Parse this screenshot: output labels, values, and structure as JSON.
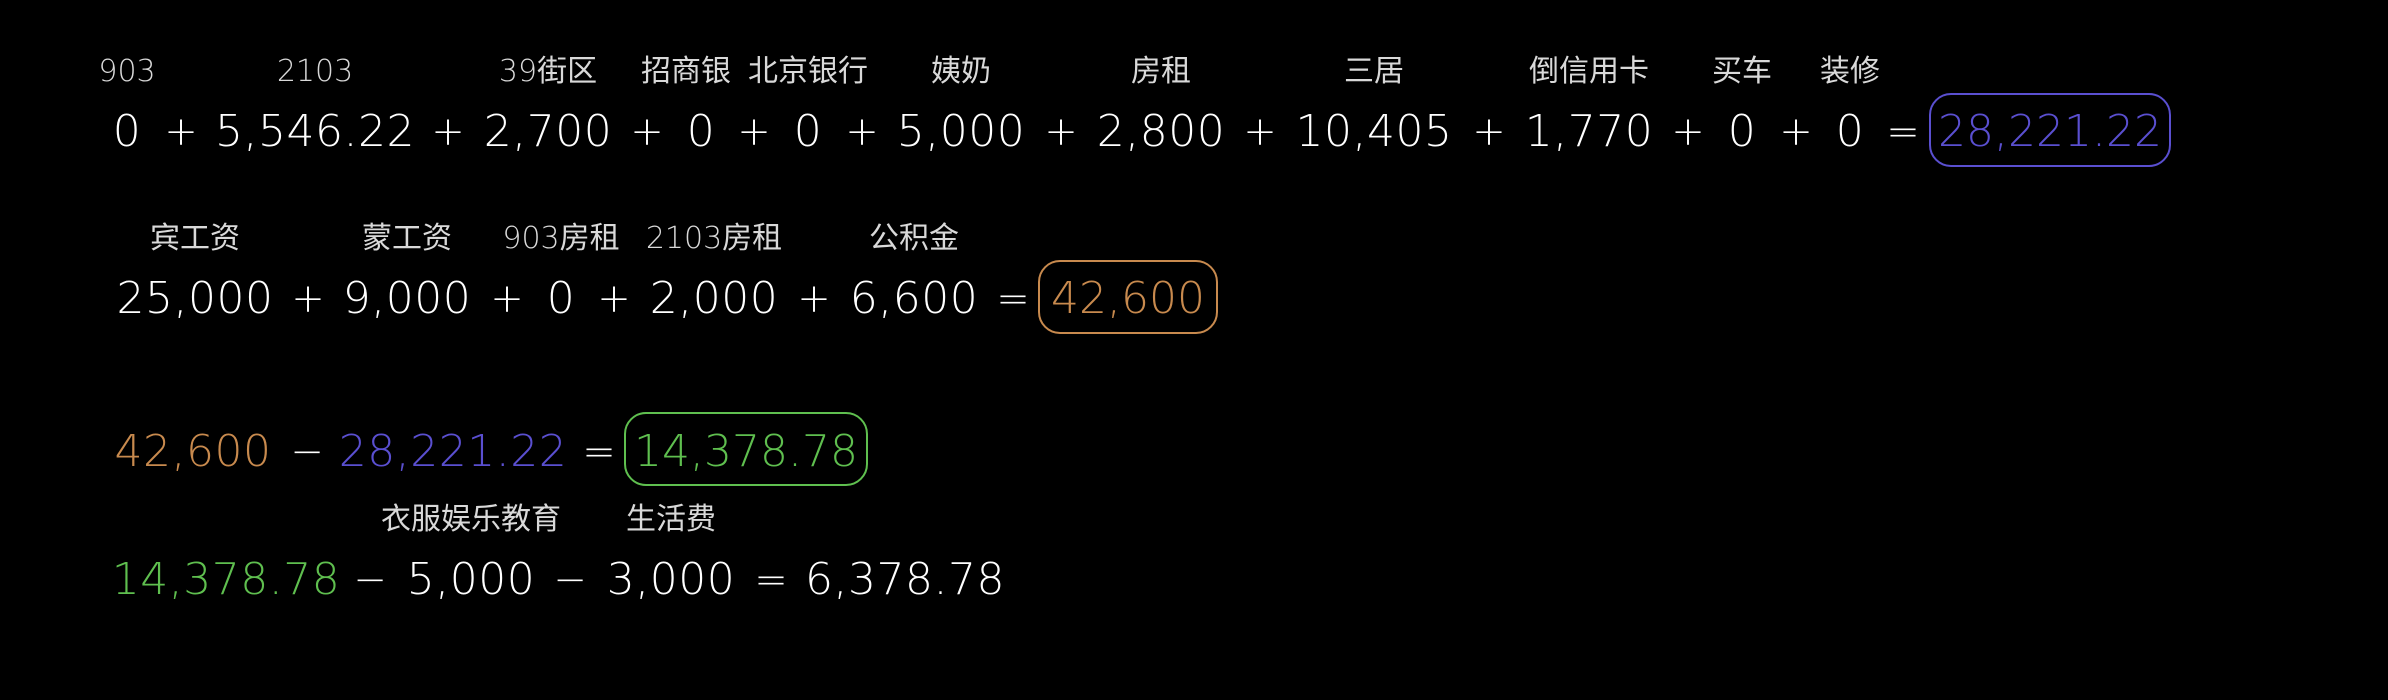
{
  "colors": {
    "background": "#000000",
    "text": "#ffffff",
    "label": "#d9d9d9",
    "expense_total": "#5a4fd0",
    "income_total": "#c88a4e",
    "surplus": "#5fbf4f"
  },
  "expenses": {
    "labels": [
      "903",
      "2103",
      "39街区",
      "招商银",
      "北京银行",
      "姨奶",
      "房租",
      "三居",
      "倒信用卡",
      "买车",
      "装修"
    ],
    "values": [
      "0",
      "5,546.22",
      "2,700",
      "0",
      "0",
      "5,000",
      "2,800",
      "10,405",
      "1,770",
      "0",
      "0"
    ],
    "plus": "+",
    "equals": "=",
    "total": "28,221.22"
  },
  "income": {
    "labels": [
      "宾工资",
      "蒙工资",
      "903房租",
      "2103房租",
      "公积金"
    ],
    "values": [
      "25,000",
      "9,000",
      "0",
      "2,000",
      "6,600"
    ],
    "plus": "+",
    "equals": "=",
    "total": "42,600"
  },
  "net": {
    "income": "42,600",
    "minus": "−",
    "expenses": "28,221.22",
    "equals": "=",
    "result": "14,378.78"
  },
  "remaining": {
    "start": "14,378.78",
    "labels": [
      "衣服娱乐教育",
      "生活费"
    ],
    "values": [
      "5,000",
      "3,000"
    ],
    "minus": "−",
    "equals": "=",
    "result": "6,378.78"
  }
}
